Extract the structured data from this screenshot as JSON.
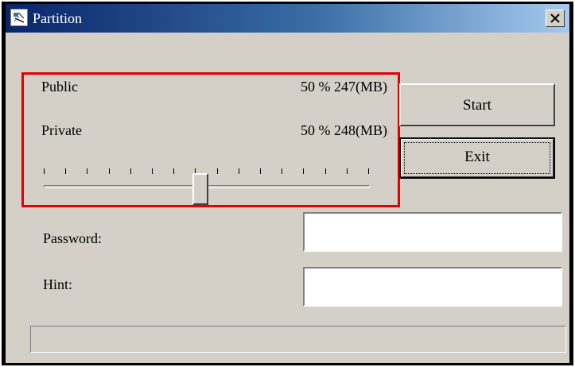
{
  "window": {
    "title": "Partition",
    "icon": "partition-app-icon",
    "close_icon": "close-icon"
  },
  "partition": {
    "public": {
      "label": "Public",
      "value": "50 % 247(MB)"
    },
    "private": {
      "label": "Private",
      "value": "50 % 248(MB)"
    },
    "slider": {
      "value_percent": 48,
      "tick_count": 16
    }
  },
  "buttons": {
    "start_label": "Start",
    "exit_label": "Exit"
  },
  "fields": {
    "password_label": "Password:",
    "password_value": "",
    "hint_label": "Hint:",
    "hint_value": ""
  },
  "status": {
    "text": ""
  },
  "colors": {
    "highlight": "#e80000",
    "window_bg": "#d4d0c8",
    "title_start": "#0a246a",
    "title_end": "#a6caf0"
  }
}
